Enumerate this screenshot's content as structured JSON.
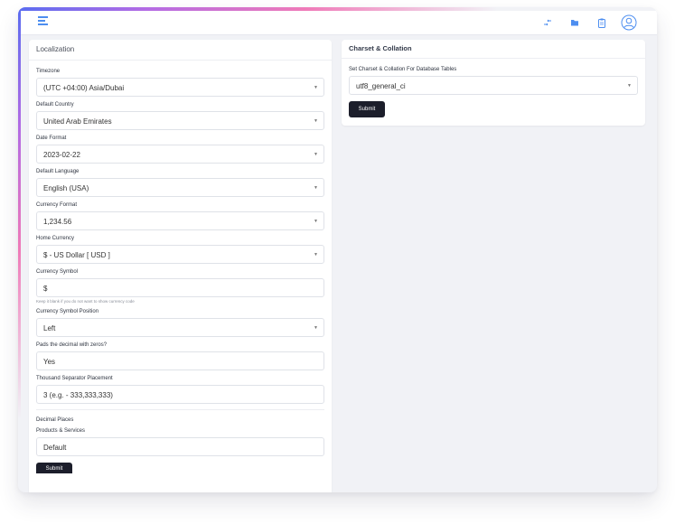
{
  "header": {
    "menu_icon": "hamburger-menu-icon",
    "icons": [
      "shuffle-icon",
      "folder-icon",
      "clipboard-icon",
      "user-avatar-icon"
    ],
    "accent_colors": [
      "#5a6cf0",
      "#b36be4",
      "#ef7ab8"
    ],
    "icon_color": "#4d8ef0"
  },
  "localization": {
    "title": "Localization",
    "fields": {
      "timezone": {
        "label": "Timezone",
        "value": "(UTC +04:00) Asia/Dubai"
      },
      "default_country": {
        "label": "Default Country",
        "value": "United Arab Emirates"
      },
      "date_format": {
        "label": "Date Format",
        "value": "2023-02-22"
      },
      "default_language": {
        "label": "Default Language",
        "value": "English (USA)"
      },
      "currency_format": {
        "label": "Currency Format",
        "value": "1,234.56"
      },
      "home_currency": {
        "label": "Home Currency",
        "value": "$ - US Dollar [ USD ]"
      },
      "currency_symbol": {
        "label": "Currency Symbol",
        "value": "$",
        "help": "Keep it blank if you do not want to show currency code"
      },
      "currency_symbol_position": {
        "label": "Currency Symbol Position",
        "value": "Left"
      },
      "pads_decimal": {
        "label": "Pads the decimal with zeros?",
        "value": "Yes"
      },
      "thousand_separator": {
        "label": "Thousand Separator Placement",
        "value": "3 (e.g. - 333,333,333)"
      }
    },
    "decimal_places_label": "Decimal Places",
    "products_services": {
      "label": "Products & Services",
      "value": "Default"
    },
    "submit_label": "Submit"
  },
  "charset": {
    "title": "Charset & Collation",
    "label": "Set Charset & Collation For Database Tables",
    "value": "utf8_general_ci",
    "submit_label": "Submit"
  }
}
